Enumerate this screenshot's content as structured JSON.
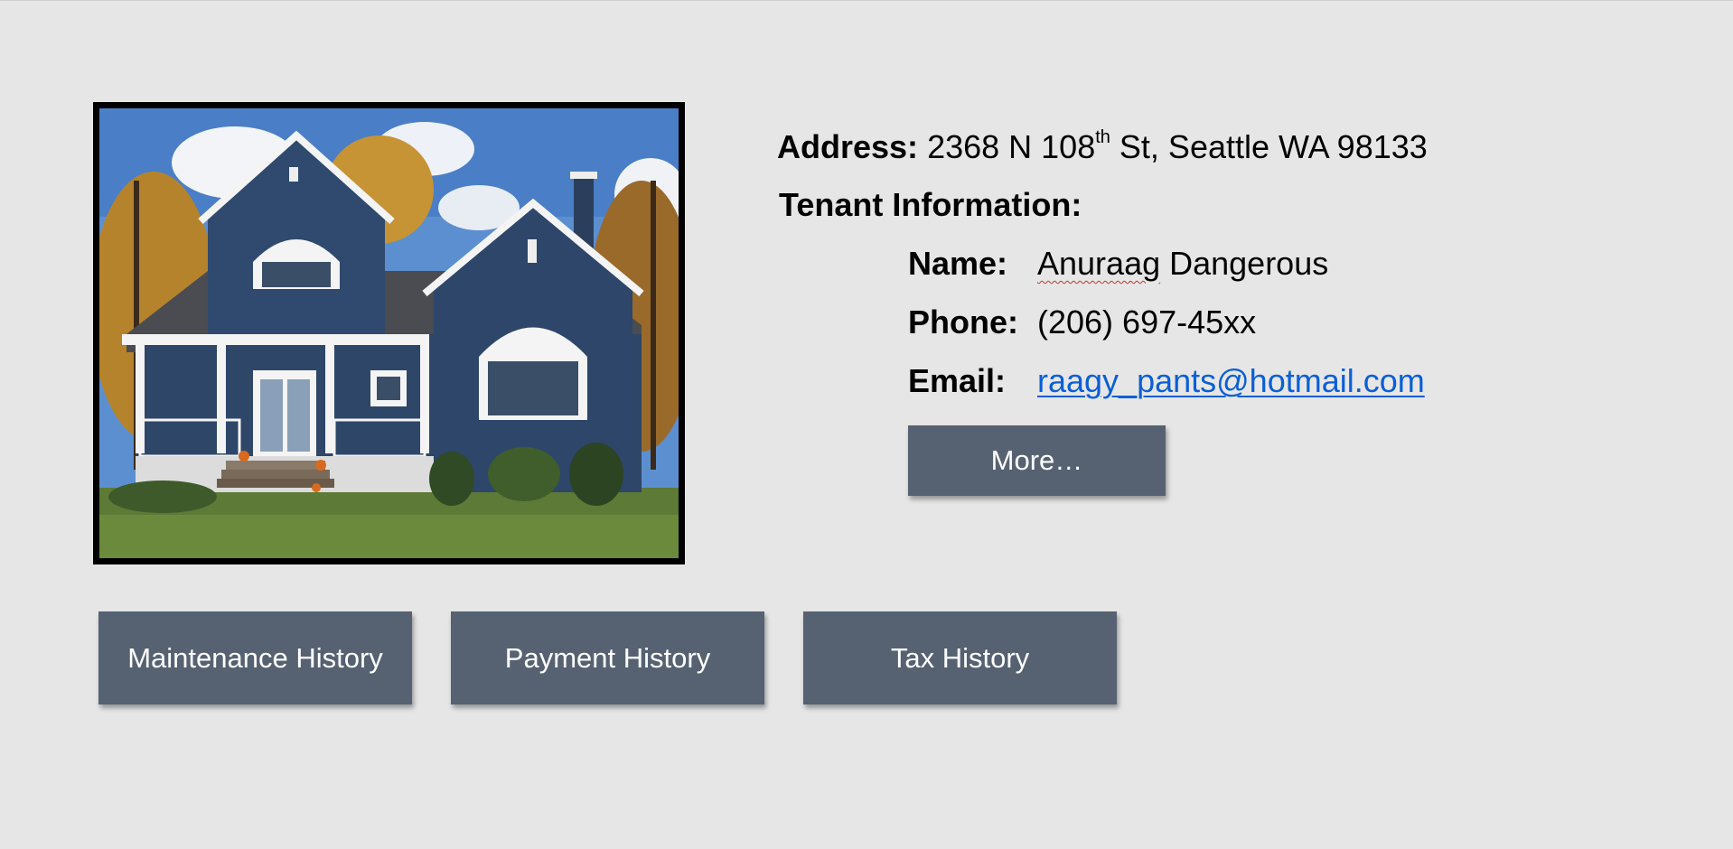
{
  "property": {
    "address_label": "Address:",
    "address_line_1": "2368 N 108",
    "address_ordinal_suffix": "th",
    "address_line_2": " St, Seattle WA 98133",
    "photo_alt": "House photo"
  },
  "tenant": {
    "section_label": "Tenant Information:",
    "name_label": "Name:",
    "name_first": "Anuraag",
    "name_last": " Dangerous",
    "phone_label": "Phone:",
    "phone_value": "(206) 697-45xx",
    "email_label": "Email:",
    "email_value": "raagy_pants@hotmail.com"
  },
  "buttons": {
    "more": "More…",
    "maintenance_history": "Maintenance History",
    "payment_history": "Payment History",
    "tax_history": "Tax History"
  },
  "colors": {
    "background": "#e6e6e6",
    "button": "#566271",
    "link": "#0b5ed7"
  }
}
